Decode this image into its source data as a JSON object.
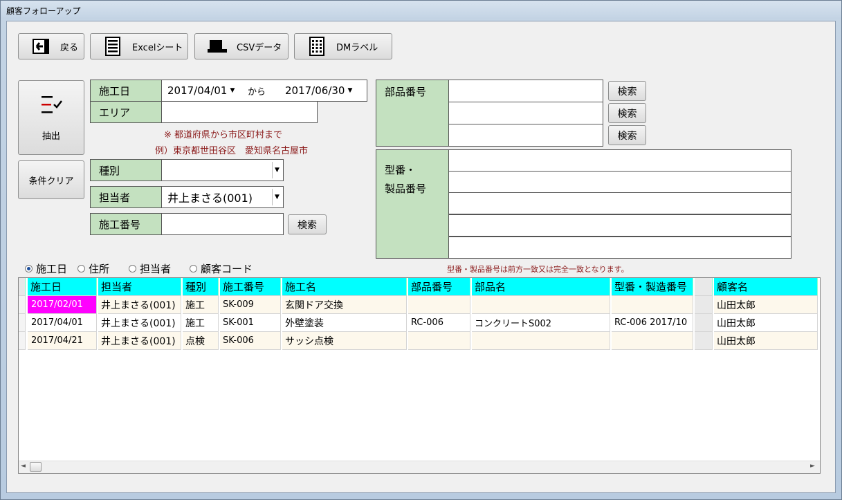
{
  "window": {
    "title": "顧客フォローアップ"
  },
  "toolbar": {
    "back_label": "戻る",
    "excel_label": "Excelシート",
    "csv_label": "CSVデータ",
    "dm_label": "DMラベル"
  },
  "side": {
    "extract_label": "抽出",
    "clear_label": "条件クリア"
  },
  "form": {
    "date_label": "施工日",
    "date_from": "2017/04/01",
    "from_text": "から",
    "date_to": "2017/06/30",
    "area_label": "エリア",
    "area_value": "",
    "note1": "※ 都道府県から市区町村まで",
    "note2": "例）東京都世田谷区　愛知県名古屋市",
    "type_label": "種別",
    "type_value": "",
    "staff_label": "担当者",
    "staff_value": "井上まさる(001)",
    "work_no_label": "施工番号",
    "work_no_value": "",
    "search_label": "検索",
    "part_label": "部品番号",
    "part_values": [
      "",
      "",
      ""
    ],
    "model_label1": "型番・",
    "model_label2": "製品番号",
    "model_values": [
      "",
      "",
      "",
      "",
      ""
    ],
    "model_note": "型番・製品番号は前方一致又は完全一致となります。"
  },
  "sort": {
    "options": [
      "施工日",
      "住所",
      "担当者",
      "顧客コード"
    ],
    "selected": 0
  },
  "grid": {
    "columns": [
      "施工日",
      "担当者",
      "種別",
      "施工番号",
      "施工名",
      "部品番号",
      "部品名",
      "型番・製造番号",
      "",
      "顧客名"
    ],
    "rows": [
      [
        "2017/02/01",
        "井上まさる(001)",
        "施工",
        "SK-009",
        "玄関ドア交換",
        "",
        "",
        "",
        "",
        "山田太郎"
      ],
      [
        "2017/04/01",
        "井上まさる(001)",
        "施工",
        "SK-001",
        "外壁塗装",
        "RC-006",
        "コンクリートS002",
        "RC-006 2017/10",
        "",
        "山田太郎"
      ],
      [
        "2017/04/21",
        "井上まさる(001)",
        "点検",
        "SK-006",
        "サッシ点検",
        "",
        "",
        "",
        "",
        "山田太郎"
      ]
    ]
  },
  "icons": {
    "back": "exit-arrow-icon",
    "excel": "document-lines-icon",
    "csv": "monitor-icon",
    "dm": "label-grid-icon",
    "extract": "checklist-icon"
  }
}
